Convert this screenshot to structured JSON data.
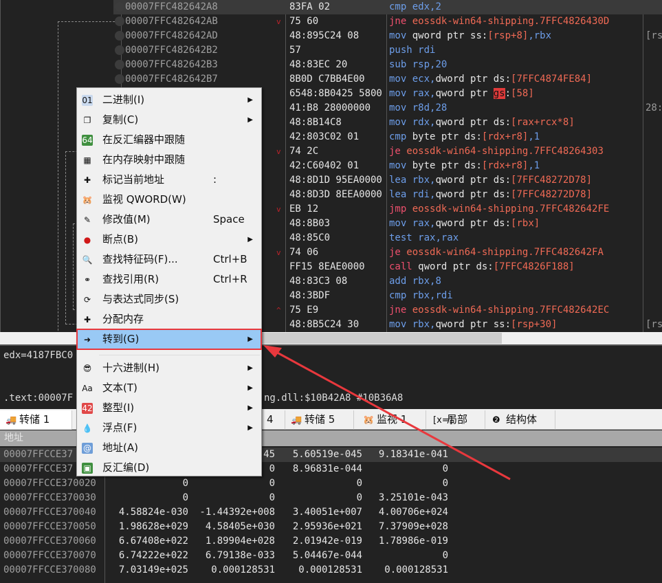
{
  "disasm": {
    "rows": [
      {
        "addr": "00007FFC482642A8",
        "bytes": "83FA 02",
        "mn": "cmp",
        "ops": [
          [
            "op",
            "edx,2"
          ]
        ],
        "selected": true
      },
      {
        "addr": "00007FFC482642AB",
        "arrow": "down",
        "bytes": "75 60",
        "mn": "jne",
        "jump": true,
        "ops": [
          [
            "tg",
            "eossdk-win64-shipping.7FFC4826430D"
          ]
        ]
      },
      {
        "addr": "00007FFC482642AD",
        "bytes": "48:895C24 08",
        "mn": "mov",
        "ops": [
          [
            "pl",
            "qword ptr ss:"
          ],
          [
            "tg",
            "[rsp+8]"
          ],
          [
            "op",
            ",rbx"
          ]
        ],
        "comment": "[rs"
      },
      {
        "addr": "00007FFC482642B2",
        "bytes": "57",
        "mn": "push",
        "ops": [
          [
            "op",
            "rdi"
          ]
        ]
      },
      {
        "addr": "00007FFC482642B3",
        "bytes": "48:83EC 20",
        "mn": "sub",
        "ops": [
          [
            "op",
            "rsp,20"
          ]
        ]
      },
      {
        "addr": "00007FFC482642B7",
        "bytes": "8B0D C7BB4E00",
        "mn": "mov",
        "ops": [
          [
            "op",
            "ecx,"
          ],
          [
            "pl",
            "dword ptr ds:"
          ],
          [
            "tg",
            "[7FFC4874FE84]"
          ]
        ]
      },
      {
        "bytes": "6548:8B0425 5800",
        "mn": "mov",
        "ops": [
          [
            "op",
            "rax,"
          ],
          [
            "pl",
            "qword ptr "
          ],
          [
            "gs",
            "gs"
          ],
          [
            "pl",
            ":"
          ],
          [
            "tg",
            "[58]"
          ]
        ]
      },
      {
        "bytes": "41:B8 28000000",
        "mn": "mov",
        "ops": [
          [
            "op",
            "r8d,28"
          ]
        ],
        "comment": "28:"
      },
      {
        "bytes": "48:8B14C8",
        "mn": "mov",
        "ops": [
          [
            "op",
            "rdx,"
          ],
          [
            "pl",
            "qword ptr ds:"
          ],
          [
            "tg",
            "[rax+rcx*8]"
          ]
        ]
      },
      {
        "bytes": "42:803C02 01",
        "mn": "cmp",
        "ops": [
          [
            "pl",
            "byte ptr ds:"
          ],
          [
            "tg",
            "[rdx+r8]"
          ],
          [
            "op",
            ",1"
          ]
        ]
      },
      {
        "arrow": "down",
        "bytes": "74 2C",
        "mn": "je",
        "jump": true,
        "ops": [
          [
            "tg",
            "eossdk-win64-shipping.7FFC48264303"
          ]
        ]
      },
      {
        "bytes": "42:C60402 01",
        "mn": "mov",
        "ops": [
          [
            "pl",
            "byte ptr ds:"
          ],
          [
            "tg",
            "[rdx+r8]"
          ],
          [
            "op",
            ",1"
          ]
        ]
      },
      {
        "bytes": "48:8D1D 95EA0000",
        "mn": "lea",
        "ops": [
          [
            "op",
            "rbx,"
          ],
          [
            "pl",
            "qword ptr ds:"
          ],
          [
            "tg",
            "[7FFC48272D78]"
          ]
        ]
      },
      {
        "bytes": "48:8D3D 8EEA0000",
        "mn": "lea",
        "ops": [
          [
            "op",
            "rdi,"
          ],
          [
            "pl",
            "qword ptr ds:"
          ],
          [
            "tg",
            "[7FFC48272D78]"
          ]
        ]
      },
      {
        "arrow": "down",
        "bytes": "EB 12",
        "mn": "jmp",
        "jump": true,
        "ops": [
          [
            "tg",
            "eossdk-win64-shipping.7FFC482642FE"
          ]
        ]
      },
      {
        "bytes": "48:8B03",
        "mn": "mov",
        "ops": [
          [
            "op",
            "rax,"
          ],
          [
            "pl",
            "qword ptr ds:"
          ],
          [
            "tg",
            "[rbx]"
          ]
        ]
      },
      {
        "bytes": "48:85C0",
        "mn": "test",
        "ops": [
          [
            "op",
            "rax,rax"
          ]
        ]
      },
      {
        "arrow": "down",
        "bytes": "74 06",
        "mn": "je",
        "jump": true,
        "ops": [
          [
            "tg",
            "eossdk-win64-shipping.7FFC482642FA"
          ]
        ]
      },
      {
        "bytes": "FF15 8EAE0000",
        "mn": "call",
        "jump": true,
        "ops": [
          [
            "pl",
            "qword ptr ds:"
          ],
          [
            "tg",
            "[7FFC4826F188]"
          ]
        ]
      },
      {
        "bytes": "48:83C3 08",
        "mn": "add",
        "ops": [
          [
            "op",
            "rbx,8"
          ]
        ]
      },
      {
        "bytes": "48:3BDF",
        "mn": "cmp",
        "ops": [
          [
            "op",
            "rbx,rdi"
          ]
        ]
      },
      {
        "arrow": "up",
        "bytes": "75 E9",
        "mn": "jne",
        "jump": true,
        "ops": [
          [
            "tg",
            "eossdk-win64-shipping.7FFC482642EC"
          ]
        ]
      },
      {
        "bytes": "48:8B5C24 30",
        "mn": "mov",
        "ops": [
          [
            "op",
            "rbx,"
          ],
          [
            "pl",
            "qword ptr ss:"
          ],
          [
            "tg",
            "[rsp+30]"
          ]
        ],
        "comment": "[rs"
      }
    ]
  },
  "info": {
    "line1": "edx=4187FBC0",
    "line2_left": ".text:00007F",
    "line2_right": "ng.dll:$10B42A8 #10B36A8"
  },
  "tabs": [
    {
      "label": "转储 1",
      "icon": "🚚",
      "active": true
    },
    {
      "label": "4",
      "icon": ""
    },
    {
      "label": "转储 5",
      "icon": "🚚"
    },
    {
      "label": "监视 1",
      "icon": "🐹"
    },
    {
      "label": "局部",
      "icon": "[x=]"
    },
    {
      "label": "结构体",
      "icon": "❷"
    }
  ],
  "dump": {
    "header": "地址",
    "rows": [
      {
        "addr": "00007FFCCE37",
        "v": [
          "",
          "45",
          "5.60519e-045",
          "9.18341e-041"
        ],
        "selected": true
      },
      {
        "addr": "00007FFCCE37",
        "v": [
          "",
          "0",
          "8.96831e-044",
          "0"
        ]
      },
      {
        "addr": "00007FFCCE370020",
        "v": [
          "0",
          "0",
          "0",
          "0"
        ]
      },
      {
        "addr": "00007FFCCE370030",
        "v": [
          "0",
          "0",
          "0",
          "3.25101e-043"
        ]
      },
      {
        "addr": "00007FFCCE370040",
        "v": [
          "4.58824e-030",
          "-1.44392e+008",
          "3.40051e+007",
          "4.00706e+024"
        ]
      },
      {
        "addr": "00007FFCCE370050",
        "v": [
          "1.98628e+029",
          "4.58405e+030",
          "2.95936e+021",
          "7.37909e+028"
        ]
      },
      {
        "addr": "00007FFCCE370060",
        "v": [
          "6.67408e+022",
          "1.89904e+028",
          "2.01942e-019",
          "1.78986e-019"
        ]
      },
      {
        "addr": "00007FFCCE370070",
        "v": [
          "6.74222e+022",
          "6.79138e-033",
          "5.04467e-044",
          "0"
        ]
      },
      {
        "addr": "00007FFCCE370080",
        "v": [
          "7.03149e+025",
          "0.000128531",
          "0.000128531",
          "0.000128531"
        ]
      }
    ]
  },
  "menu": {
    "items": [
      {
        "label": "二进制(I)",
        "icon": "binary-icon",
        "glyph": "01",
        "bg": "#c9d9ee",
        "submenu": true
      },
      {
        "label": "复制(C)",
        "icon": "copy-icon",
        "glyph": "❐",
        "bg": "#f0f0f0",
        "submenu": true
      },
      {
        "label": "在反汇编器中跟随",
        "icon": "cpu-icon",
        "glyph": "64",
        "bg": "#3f8f3f"
      },
      {
        "label": "在内存映射中跟随",
        "icon": "memory-map-icon",
        "glyph": "▦",
        "bg": "#f0f0f0"
      },
      {
        "label": "标记当前地址",
        "icon": "label-add-icon",
        "glyph": "✚",
        "bg": "#f0f0f0",
        "shortcut": ":"
      },
      {
        "label": "监视 QWORD(W)",
        "icon": "watch-icon",
        "glyph": "🐹",
        "bg": "#f0f0f0"
      },
      {
        "label": "修改值(M)",
        "icon": "pencil-icon",
        "glyph": "✎",
        "bg": "#f0f0f0",
        "shortcut": "Space"
      },
      {
        "label": "断点(B)",
        "icon": "breakpoint-icon",
        "glyph": "●",
        "bg": "#f0f0f0",
        "submenu": true
      },
      {
        "label": "查找特征码(F)...",
        "icon": "find-pattern-icon",
        "glyph": "🔍",
        "bg": "#f0f0f0",
        "shortcut": "Ctrl+B"
      },
      {
        "label": "查找引用(R)",
        "icon": "binoculars-icon",
        "glyph": "⚭",
        "bg": "#f0f0f0",
        "shortcut": "Ctrl+R"
      },
      {
        "label": "与表达式同步(S)",
        "icon": "sync-icon",
        "glyph": "⟳",
        "bg": "#f0f0f0"
      },
      {
        "label": "分配内存",
        "icon": "allocate-memory-icon",
        "glyph": "✚",
        "bg": "#f0f0f0"
      },
      {
        "label": "转到(G)",
        "icon": "goto-icon",
        "glyph": "➜",
        "bg": "#99c9f5",
        "submenu": true,
        "highlighted": true
      },
      {
        "separator": true
      },
      {
        "label": "十六进制(H)",
        "icon": "hex-icon",
        "glyph": "😎",
        "bg": "#f0f0f0",
        "submenu": true
      },
      {
        "label": "文本(T)",
        "icon": "text-icon",
        "glyph": "Aa",
        "bg": "#f0f0f0",
        "submenu": true
      },
      {
        "label": "整型(I)",
        "icon": "integer-icon",
        "glyph": "42",
        "bg": "#e04848",
        "submenu": true
      },
      {
        "label": "浮点(F)",
        "icon": "float-icon",
        "glyph": "💧",
        "bg": "#f0f0f0",
        "submenu": true
      },
      {
        "label": "地址(A)",
        "icon": "address-icon",
        "glyph": "@",
        "bg": "#6f9ed8"
      },
      {
        "label": "反汇编(D)",
        "icon": "disassemble-icon",
        "glyph": "▣",
        "bg": "#3f8f3f"
      }
    ]
  },
  "annotation_color": "#e8383d"
}
